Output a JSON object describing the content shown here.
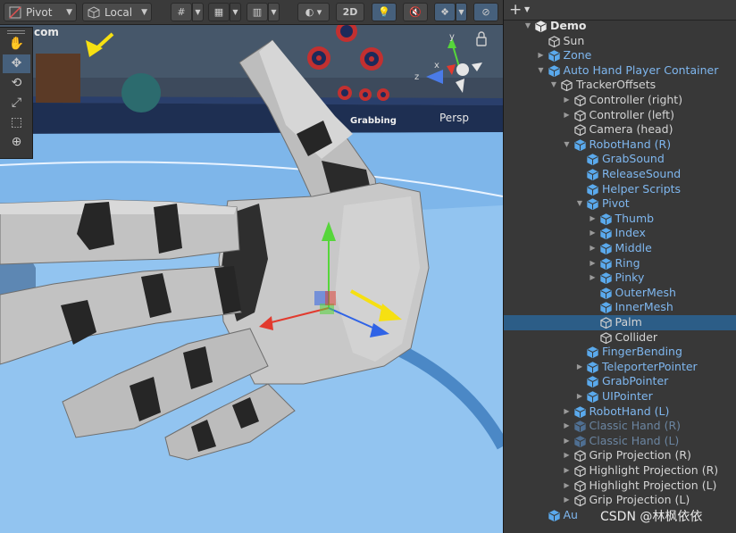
{
  "toolbar": {
    "pivot_label": "Pivot",
    "local_label": "Local",
    "mode_2d_label": "2D"
  },
  "scene": {
    "persp_label": "Persp",
    "axis_y": "y",
    "axis_x": "x",
    "axis_z": "z",
    "sign_text": "Grabbing",
    "corner_text": "com"
  },
  "hierarchy": {
    "rows": [
      {
        "label": "Demo",
        "indent": 0,
        "arrow": "down",
        "icon": "unity-scene",
        "style": "scene"
      },
      {
        "label": "Sun",
        "indent": 1,
        "arrow": "",
        "icon": "cube",
        "style": "normal"
      },
      {
        "label": "Zone",
        "indent": 1,
        "arrow": "right",
        "icon": "prefab",
        "style": "prefab"
      },
      {
        "label": "Auto Hand Player Container",
        "indent": 1,
        "arrow": "down",
        "icon": "prefab",
        "style": "prefab"
      },
      {
        "label": "TrackerOffsets",
        "indent": 2,
        "arrow": "down",
        "icon": "cube",
        "style": "normal"
      },
      {
        "label": "Controller (right)",
        "indent": 3,
        "arrow": "right",
        "icon": "cube",
        "style": "normal"
      },
      {
        "label": "Controller (left)",
        "indent": 3,
        "arrow": "right",
        "icon": "cube",
        "style": "normal"
      },
      {
        "label": "Camera (head)",
        "indent": 3,
        "arrow": "",
        "icon": "cube",
        "style": "normal"
      },
      {
        "label": "RobotHand (R)",
        "indent": 3,
        "arrow": "down",
        "icon": "prefab",
        "style": "prefab"
      },
      {
        "label": "GrabSound",
        "indent": 4,
        "arrow": "",
        "icon": "prefab",
        "style": "prefab"
      },
      {
        "label": "ReleaseSound",
        "indent": 4,
        "arrow": "",
        "icon": "prefab",
        "style": "prefab"
      },
      {
        "label": "Helper Scripts",
        "indent": 4,
        "arrow": "",
        "icon": "prefab",
        "style": "prefab"
      },
      {
        "label": "Pivot",
        "indent": 4,
        "arrow": "down",
        "icon": "prefab",
        "style": "prefab"
      },
      {
        "label": "Thumb",
        "indent": 5,
        "arrow": "right",
        "icon": "prefab",
        "style": "prefab"
      },
      {
        "label": "Index",
        "indent": 5,
        "arrow": "right",
        "icon": "prefab",
        "style": "prefab"
      },
      {
        "label": "Middle",
        "indent": 5,
        "arrow": "right",
        "icon": "prefab",
        "style": "prefab"
      },
      {
        "label": "Ring",
        "indent": 5,
        "arrow": "right",
        "icon": "prefab",
        "style": "prefab"
      },
      {
        "label": "Pinky",
        "indent": 5,
        "arrow": "right",
        "icon": "prefab",
        "style": "prefab"
      },
      {
        "label": "OuterMesh",
        "indent": 5,
        "arrow": "",
        "icon": "prefab",
        "style": "prefab"
      },
      {
        "label": "InnerMesh",
        "indent": 5,
        "arrow": "",
        "icon": "prefab",
        "style": "prefab"
      },
      {
        "label": "Palm",
        "indent": 5,
        "arrow": "",
        "icon": "cube",
        "style": "selected"
      },
      {
        "label": "Collider",
        "indent": 5,
        "arrow": "",
        "icon": "cube",
        "style": "normal"
      },
      {
        "label": "FingerBending",
        "indent": 4,
        "arrow": "",
        "icon": "prefab",
        "style": "prefab"
      },
      {
        "label": "TeleporterPointer",
        "indent": 4,
        "arrow": "right",
        "icon": "prefab",
        "style": "prefab"
      },
      {
        "label": "GrabPointer",
        "indent": 4,
        "arrow": "",
        "icon": "prefab",
        "style": "prefab"
      },
      {
        "label": "UIPointer",
        "indent": 4,
        "arrow": "right",
        "icon": "prefab",
        "style": "prefab"
      },
      {
        "label": "RobotHand (L)",
        "indent": 3,
        "arrow": "right",
        "icon": "prefab",
        "style": "prefab"
      },
      {
        "label": "Classic Hand (R)",
        "indent": 3,
        "arrow": "right",
        "icon": "prefab",
        "style": "dim"
      },
      {
        "label": "Classic Hand (L)",
        "indent": 3,
        "arrow": "right",
        "icon": "prefab",
        "style": "dim"
      },
      {
        "label": "Grip Projection (R)",
        "indent": 3,
        "arrow": "right",
        "icon": "cube",
        "style": "normal"
      },
      {
        "label": "Highlight Projection (R)",
        "indent": 3,
        "arrow": "right",
        "icon": "cube",
        "style": "normal"
      },
      {
        "label": "Highlight Projection (L)",
        "indent": 3,
        "arrow": "right",
        "icon": "cube",
        "style": "normal"
      },
      {
        "label": "Grip Projection (L)",
        "indent": 3,
        "arrow": "right",
        "icon": "cube",
        "style": "normal"
      },
      {
        "label": "Au",
        "indent": 1,
        "arrow": "",
        "icon": "prefab",
        "style": "prefab"
      }
    ]
  },
  "watermark": "CSDN @林枫依依",
  "colors": {
    "selection": "#2c5d87",
    "prefab_text": "#7fb7ef",
    "annotation_arrow": "#f6e012",
    "gizmo_x": "#e23a2e",
    "gizmo_y": "#56d63a",
    "gizmo_z": "#2f63e6"
  }
}
